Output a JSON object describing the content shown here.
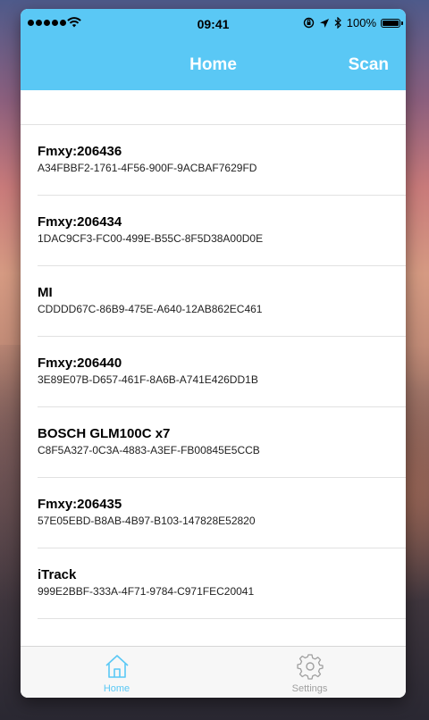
{
  "statusbar": {
    "time": "09:41",
    "battery": "100%"
  },
  "navbar": {
    "title": "Home",
    "scan_label": "Scan"
  },
  "devices": [
    {
      "name": "Fmxy:206436",
      "uuid": "A34FBBF2-1761-4F56-900F-9ACBAF7629FD"
    },
    {
      "name": "Fmxy:206434",
      "uuid": "1DAC9CF3-FC00-499E-B55C-8F5D38A00D0E"
    },
    {
      "name": "MI",
      "uuid": "CDDDD67C-86B9-475E-A640-12AB862EC461"
    },
    {
      "name": "Fmxy:206440",
      "uuid": "3E89E07B-D657-461F-8A6B-A741E426DD1B"
    },
    {
      "name": "BOSCH GLM100C x7",
      "uuid": "C8F5A327-0C3A-4883-A3EF-FB00845E5CCB"
    },
    {
      "name": "Fmxy:206435",
      "uuid": "57E05EBD-B8AB-4B97-B103-147828E52820"
    },
    {
      "name": "iTrack",
      "uuid": "999E2BBF-333A-4F71-9784-C971FEC20041"
    }
  ],
  "tabbar": {
    "home_label": "Home",
    "settings_label": "Settings"
  },
  "colors": {
    "accent": "#5ac8f5",
    "tab_inactive": "#a0a0a0"
  },
  "icons": {
    "home": "home-icon",
    "settings": "gear-icon"
  }
}
